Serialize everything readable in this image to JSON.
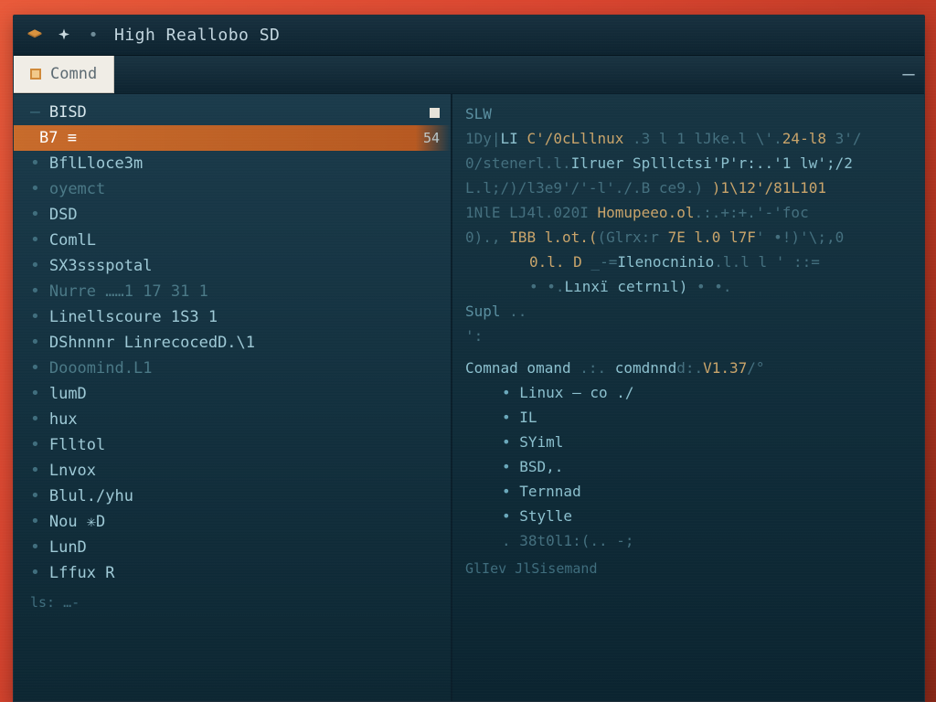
{
  "titlebar": {
    "title": "High Reallobo SD"
  },
  "tabs": {
    "active": "Comnd"
  },
  "left": {
    "items": [
      {
        "label": "BISD",
        "style": "hdr",
        "meta": "",
        "chip": true
      },
      {
        "label": "B7  ≡",
        "style": "sel",
        "meta": "54"
      },
      {
        "label": "BflLloce3m",
        "style": "soft"
      },
      {
        "label": "oyemct",
        "style": "mut"
      },
      {
        "label": "DSD",
        "style": "soft"
      },
      {
        "label": "ComlL",
        "style": "soft"
      },
      {
        "label": "SX3ssspotal",
        "style": "soft"
      },
      {
        "label": "Nurre  ……1   17 31 1",
        "style": "mut"
      },
      {
        "label": "Linellscoure  1S3 1",
        "style": "soft"
      },
      {
        "label": "DShnnnr   LinrecocedD.\\1",
        "style": "soft"
      },
      {
        "label": "Dooomind.L1",
        "style": "mut"
      },
      {
        "label": "lumD",
        "style": "soft"
      },
      {
        "label": "hux",
        "style": "soft"
      },
      {
        "label": "Flltol",
        "style": "soft"
      },
      {
        "label": "Lnvox",
        "style": "soft"
      },
      {
        "label": "Blul./yhu",
        "style": "soft"
      },
      {
        "label": "Nou ✳D",
        "style": "soft"
      },
      {
        "label": "LunD",
        "style": "soft"
      },
      {
        "label": "Lffux  R",
        "style": "soft"
      }
    ],
    "footer": "ls: …-"
  },
  "right": {
    "lines": [
      {
        "segs": [
          {
            "t": "SLW",
            "c": "lead"
          }
        ]
      },
      {
        "segs": [
          {
            "t": "1Dy|",
            "c": "dim"
          },
          {
            "t": "LI  ",
            "c": "tok2"
          },
          {
            "t": "C'/0cLllnux ",
            "c": "tok1"
          },
          {
            "t": ".3 l 1  lJke.l \\'.",
            "c": "dim"
          },
          {
            "t": "24-l8 ",
            "c": "tok1"
          },
          {
            "t": "3'/",
            "c": "dim"
          }
        ]
      },
      {
        "segs": [
          {
            "t": "0/stenerl.l.",
            "c": "dim"
          },
          {
            "t": "Ilruer Splllctsi'P'r:..'1 lw';/2",
            "c": "tok2"
          }
        ]
      },
      {
        "segs": [
          {
            "t": "L.l;/)/l3e9'/'-l'./.B ce9.)",
            "c": "dim"
          },
          {
            "t": "  )1\\12'/81L101",
            "c": "tok1"
          }
        ]
      },
      {
        "segs": [
          {
            "t": "1NlE LJ4l.020I ",
            "c": "dim"
          },
          {
            "t": "Homupeeo.ol",
            "c": "tok1"
          },
          {
            "t": ".:.+:+.'-'foc",
            "c": "dim"
          }
        ]
      },
      {
        "segs": [
          {
            "t": "0)., ",
            "c": "dim"
          },
          {
            "t": "IBB l.ot.(",
            "c": "tok1"
          },
          {
            "t": "(Glrx:r ",
            "c": "dim"
          },
          {
            "t": "7E l.0 l7F",
            "c": "tok1"
          },
          {
            "t": "' •!)'\\;,0",
            "c": "dim"
          }
        ]
      },
      {
        "segs": [
          {
            "t": "0.l. D",
            "c": "tok1"
          },
          {
            "t": "   _-=",
            "c": "dim"
          },
          {
            "t": "Ilenocninio",
            "c": "tok2"
          },
          {
            "t": ".l.l l ' ::=",
            "c": "dim"
          }
        ],
        "indent": "indent"
      },
      {
        "segs": [
          {
            "t": "• •.",
            "c": "dim"
          },
          {
            "t": "Lınxï cetrnıl)",
            "c": "tok2"
          },
          {
            "t": " • •.",
            "c": "dim"
          }
        ],
        "indent": "indent"
      },
      {
        "segs": [
          {
            "t": "Supl",
            "c": "lead"
          },
          {
            "t": "  ..",
            "c": "dim"
          }
        ]
      },
      {
        "segs": [
          {
            "t": "':",
            "c": "dim"
          }
        ]
      },
      {
        "segs": [
          {
            "t": "Comnad omand",
            "c": "tok2"
          },
          {
            "t": " .:. ",
            "c": "dim"
          },
          {
            "t": "comdnnd",
            "c": "tok2"
          },
          {
            "t": "d:.",
            "c": "dim"
          },
          {
            "t": "V1.37",
            "c": "tok1"
          },
          {
            "t": "/°",
            "c": "dim"
          }
        ],
        "sect": true
      },
      {
        "segs": [
          {
            "t": "Linux – co   ./",
            "c": "tok2"
          }
        ],
        "bul": true,
        "indent": "indent2"
      },
      {
        "segs": [
          {
            "t": "IL",
            "c": "tok2"
          }
        ],
        "bul": true,
        "indent": "indent2"
      },
      {
        "segs": [
          {
            "t": "SYiml",
            "c": "tok2"
          }
        ],
        "bul": true,
        "indent": "indent2"
      },
      {
        "segs": [
          {
            "t": "BSD,.",
            "c": "tok2"
          }
        ],
        "bul": true,
        "indent": "indent2"
      },
      {
        "segs": [
          {
            "t": "Ternnad",
            "c": "tok2"
          }
        ],
        "bul": true,
        "indent": "indent2"
      },
      {
        "segs": [
          {
            "t": "Stylle",
            "c": "tok2"
          }
        ],
        "bul": true,
        "indent": "indent2"
      },
      {
        "segs": [
          {
            "t": ". 38t0l1:(.. -;",
            "c": "dim"
          }
        ],
        "indent": "indent2"
      }
    ],
    "footer": "GlIev JlSisemand"
  },
  "colors": {
    "accent": "#c76a2a",
    "bg": "#12303e",
    "text_soft": "#7fb8c9",
    "text_warm": "#d09a62"
  }
}
